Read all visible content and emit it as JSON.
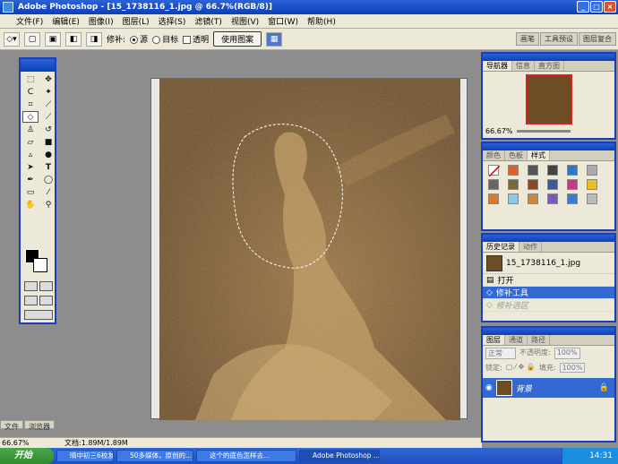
{
  "window": {
    "title": "Adobe Photoshop - [15_1738116_1.jpg @ 66.7%(RGB/8)]",
    "min": "_",
    "max": "□",
    "close": "×"
  },
  "menu": [
    "文件(F)",
    "编辑(E)",
    "图像(I)",
    "图层(L)",
    "选择(S)",
    "滤镜(T)",
    "视图(V)",
    "窗口(W)",
    "帮助(H)"
  ],
  "options": {
    "patch_label": "修补:",
    "source": "源",
    "target": "目标",
    "transparent": "透明",
    "use_pattern": "使用图案"
  },
  "wells": [
    "画笔",
    "工具预设",
    "图层复合"
  ],
  "status": {
    "zoom": "66.67%",
    "doc": "文档:1.89M/1.89M"
  },
  "side_tabs": [
    "文件",
    "浏览器"
  ],
  "navigator": {
    "tabs": [
      "导航器",
      "信息",
      "直方图"
    ],
    "zoom": "66.67%"
  },
  "styles": {
    "tabs": [
      "颜色",
      "色板",
      "样式"
    ]
  },
  "history": {
    "tabs": [
      "历史记录",
      "动作"
    ],
    "snapshot": "15_1738116_1.jpg",
    "items": [
      "打开",
      "修补工具",
      "修补选区"
    ]
  },
  "layers": {
    "tabs": [
      "图层",
      "通道",
      "路径"
    ],
    "blend": "正常",
    "opacity_label": "不透明度:",
    "opacity": "100%",
    "lock_label": "锁定:",
    "fill_label": "填充:",
    "fill": "100%",
    "layer_name": "背景"
  },
  "taskbar": {
    "start": "开始",
    "tasks": [
      "晴中初三6校友...",
      "50多媒体，原创的...",
      "这个的底色怎样去...",
      "Adobe Photoshop ..."
    ],
    "time": "14:31"
  }
}
